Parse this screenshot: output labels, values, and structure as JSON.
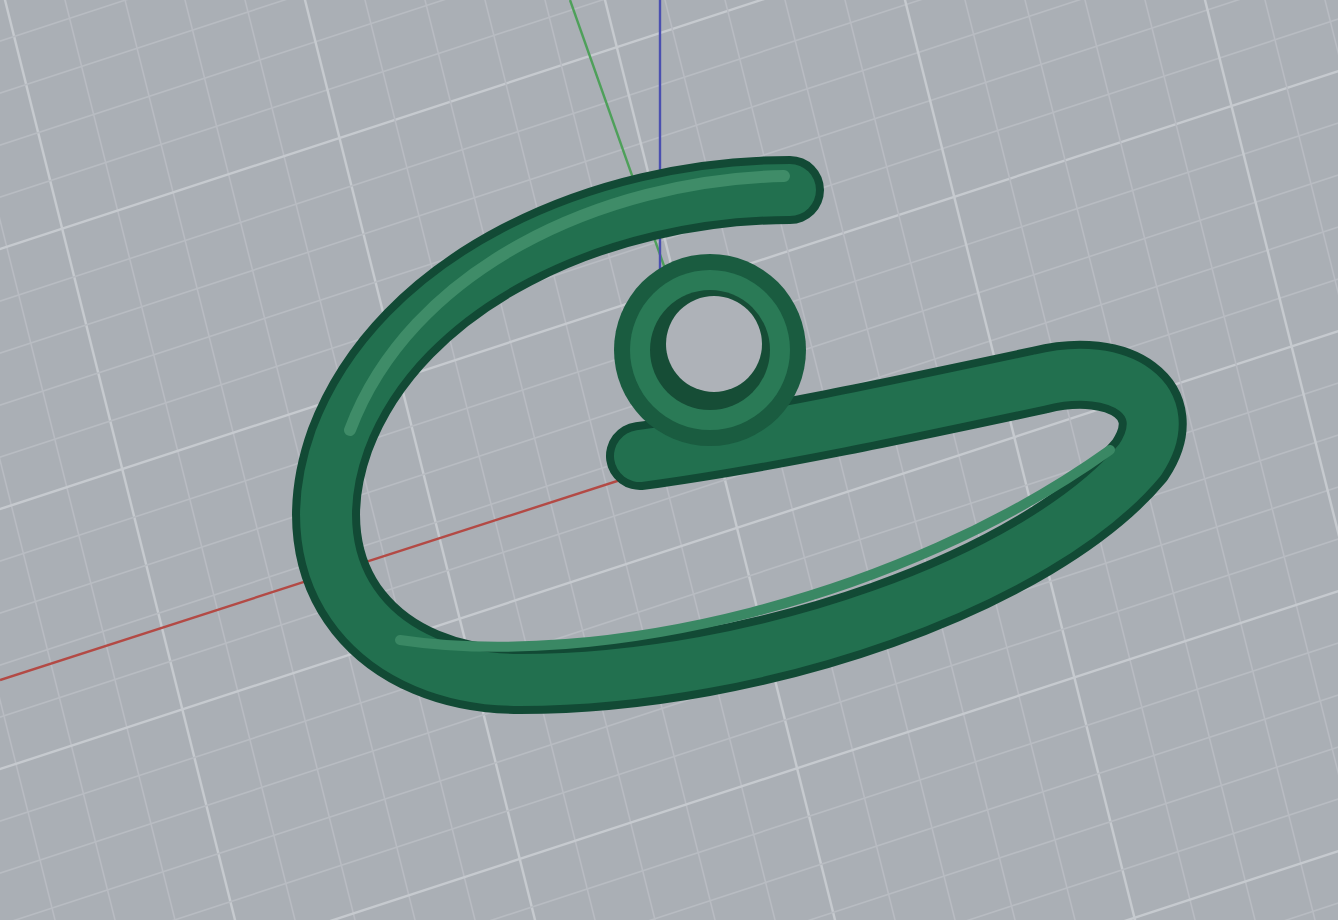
{
  "viewport": {
    "grid_visible": true,
    "axes_visible": true
  }
}
